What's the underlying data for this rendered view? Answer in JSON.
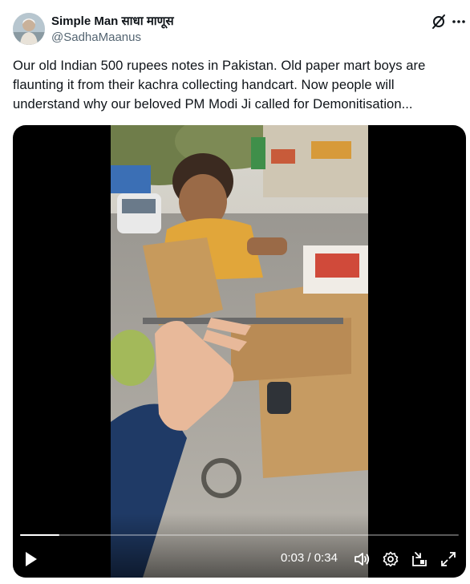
{
  "author": {
    "display_name": "Simple Man साधा माणूस",
    "handle": "@SadhaMaanus"
  },
  "tweet": {
    "text_lines": [
      "Our old Indian 500 rupees notes in Pakistan. Old paper mart boys are",
      "flaunting it from their kachra collecting handcart. Now people will",
      "understand why our beloved PM Modi Ji called for Demonitisation..."
    ]
  },
  "video": {
    "current_time": "0:03",
    "separator": "/",
    "duration": "0:34",
    "progress": 0.09
  },
  "icons": {
    "grok": "grok-icon",
    "more": "more-icon",
    "play": "play-icon",
    "volume": "volume-icon",
    "settings": "gear-icon",
    "pip": "picture-in-picture-icon",
    "fullscreen": "fullscreen-icon"
  },
  "colors": {
    "text_primary": "#0f1419",
    "text_secondary": "#536471",
    "video_background": "#000000",
    "control_white": "#ffffff"
  }
}
